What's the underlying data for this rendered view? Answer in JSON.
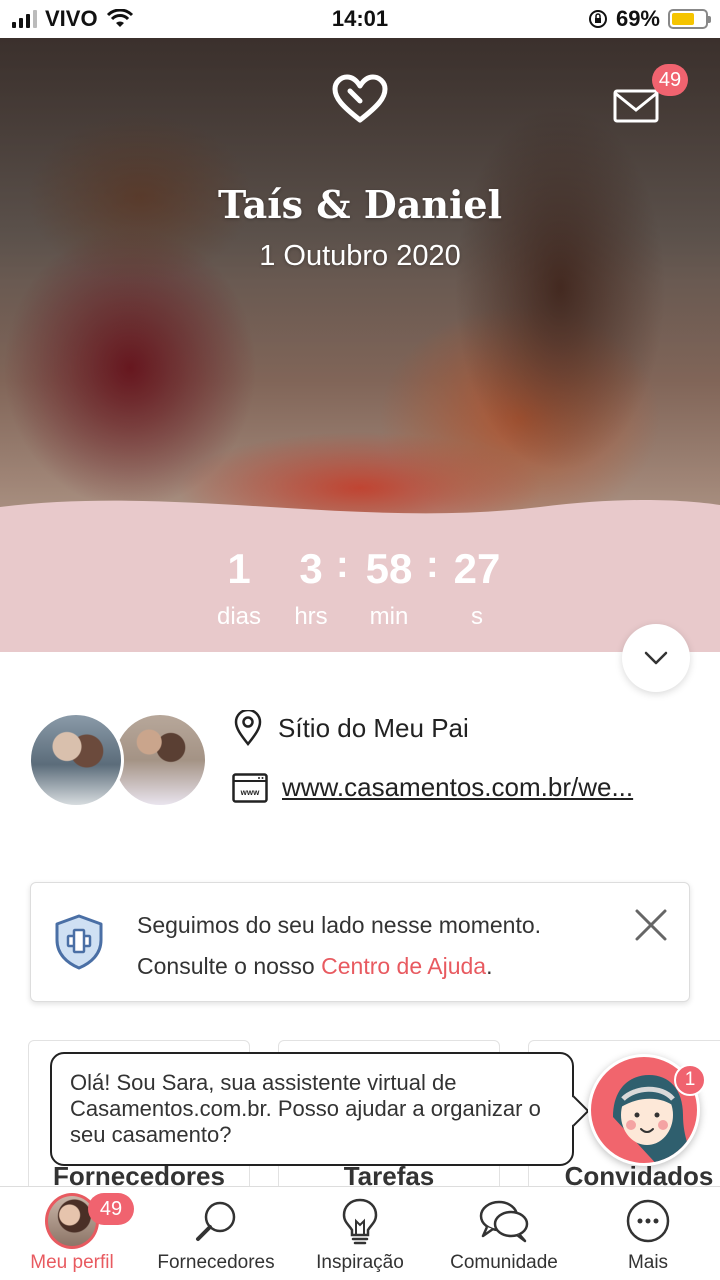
{
  "status_bar": {
    "carrier": "VIVO",
    "time": "14:01",
    "battery": "69%",
    "battery_level": 0.69,
    "icons": [
      "signal-icon",
      "wifi-icon",
      "rotation-lock-icon",
      "battery-icon"
    ]
  },
  "hero": {
    "icon": "heart-icon",
    "couple_names": "Taís & Daniel",
    "wedding_date": "1 Outubro 2020",
    "messages_badge": "49"
  },
  "countdown": {
    "days": "1",
    "days_label": "dias",
    "hours": "3",
    "hours_label": "hrs",
    "minutes": "58",
    "minutes_label": "min",
    "seconds": "27",
    "seconds_label": "s",
    "separator": ":"
  },
  "profile": {
    "venue": "Sítio do Meu Pai",
    "website": "www.casamentos.com.br/we..."
  },
  "help_card": {
    "line1": "Seguimos do seu lado nesse momento.",
    "line2_prefix": "Consulte o nosso ",
    "link": "Centro de Ajuda",
    "line2_suffix": "."
  },
  "cards": [
    {
      "title": "Fornecedores"
    },
    {
      "title": "Tarefas"
    },
    {
      "title": "Convidados"
    }
  ],
  "assistant": {
    "message": "Olá! Sou Sara, sua assistente virtual de Casamentos.com.br. Posso ajudar a organizar o seu casamento?",
    "badge": "1"
  },
  "tab_bar": {
    "items": [
      {
        "label": "Meu perfil",
        "badge": "49",
        "icon": "profile-avatar"
      },
      {
        "label": "Fornecedores",
        "icon": "search-icon"
      },
      {
        "label": "Inspiração",
        "icon": "lightbulb-icon"
      },
      {
        "label": "Comunidade",
        "icon": "chat-bubbles-icon"
      },
      {
        "label": "Mais",
        "icon": "more-icon"
      }
    ]
  },
  "colors": {
    "accent": "#e85a60",
    "badge": "#f0636f",
    "countdown_bg": "#e8c9cb",
    "battery": "#f5c400"
  }
}
